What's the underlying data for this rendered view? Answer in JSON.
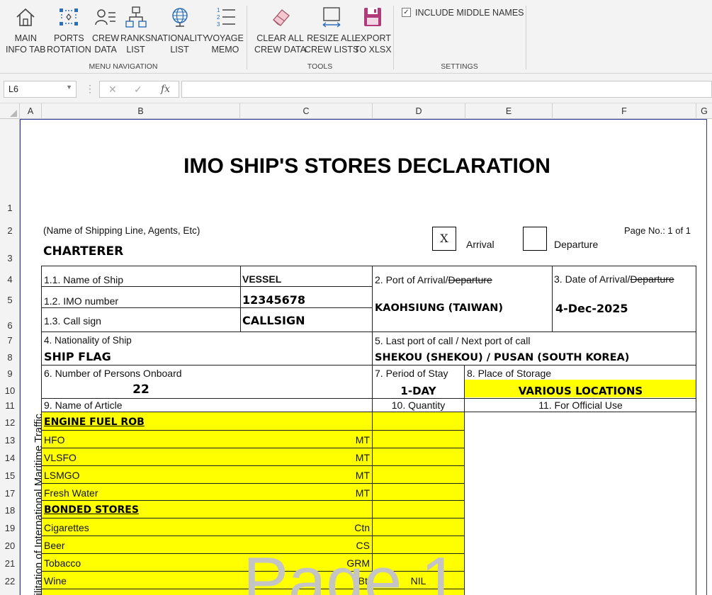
{
  "ribbon": {
    "buttons": [
      {
        "l1": "MAIN",
        "l2": "INFO TAB"
      },
      {
        "l1": "PORTS",
        "l2": "ROTATION"
      },
      {
        "l1": "CREW",
        "l2": "DATA"
      },
      {
        "l1": "RANKS",
        "l2": "LIST"
      },
      {
        "l1": "NATIONALITY",
        "l2": "LIST"
      },
      {
        "l1": "VOYAGE",
        "l2": "MEMO"
      },
      {
        "l1": "CLEAR ALL",
        "l2": "CREW DATA"
      },
      {
        "l1": "RESIZE ALL",
        "l2": "CREW LISTS"
      },
      {
        "l1": "EXPORT",
        "l2": "TO XLSX"
      }
    ],
    "groups": {
      "nav": "MENU NAVIGATION",
      "tools": "TOOLS",
      "settings": "SETTINGS"
    },
    "checkbox_label": "INCLUDE MIDDLE NAMES",
    "checkbox_mark": "✓"
  },
  "formula_bar": {
    "name_box": "L6",
    "fx": "fx",
    "formula": ""
  },
  "columns": [
    "A",
    "B",
    "C",
    "D",
    "E",
    "F",
    "G"
  ],
  "rows": [
    "1",
    "2",
    "3",
    "4",
    "5",
    "6",
    "7",
    "8",
    "9",
    "10",
    "11",
    "12",
    "13",
    "14",
    "15",
    "17",
    "18",
    "19",
    "20",
    "21",
    "22"
  ],
  "sheet": {
    "title": "IMO SHIP'S STORES DECLARATION",
    "shipping_line_label": "(Name of Shipping Line, Agents, Etc)",
    "shipping_line": "CHARTERER",
    "arrival_mark": "X",
    "arrival_label": "Arrival",
    "departure_label": "Departure",
    "page_no": "Page No.: 1 of 1",
    "ship_name_label": "1.1. Name of Ship",
    "ship_name": "VESSEL",
    "port_label_a": "2. Port of Arrival/",
    "port_label_b": "Departure",
    "date_label_a": "3. Date of Arrival/",
    "date_label_b": "Departure",
    "imo_label": "1.2. IMO number",
    "imo": "12345678",
    "port": "KAOHSIUNG (TAIWAN)",
    "date": "4-Dec-2025",
    "call_sign_label": "1.3. Call sign",
    "call_sign": "CALLSIGN",
    "nationality_label": "4. Nationality of Ship",
    "nationality": "SHIP FLAG",
    "last_port_label": "5. Last port of call / Next port of call",
    "last_port": "SHEKOU (SHEKOU) / PUSAN (SOUTH KOREA)",
    "persons_label": "6. Number of Persons Onboard",
    "persons": "22",
    "stay_label": "7. Period of Stay",
    "stay": "1-DAY",
    "storage_label": "8. Place of Storage",
    "storage": "VARIOUS LOCATIONS",
    "article_label": "9. Name of Article",
    "quantity_label": "10. Quantity",
    "official_label": "11. For Official Use",
    "side_text": "cilitation of International Maritime Traffic",
    "watermark": "Page 1",
    "articles": [
      {
        "name": "ENGINE FUEL ROB",
        "unit": "",
        "qty": "",
        "header": true
      },
      {
        "name": "HFO",
        "unit": "MT",
        "qty": ""
      },
      {
        "name": "VLSFO",
        "unit": "MT",
        "qty": ""
      },
      {
        "name": "LSMGO",
        "unit": "MT",
        "qty": ""
      },
      {
        "name": "Fresh Water",
        "unit": "MT",
        "qty": ""
      },
      {
        "name": "BONDED STORES",
        "unit": "",
        "qty": "",
        "header": true
      },
      {
        "name": "Cigarettes",
        "unit": "Ctn",
        "qty": ""
      },
      {
        "name": "Beer",
        "unit": "CS",
        "qty": ""
      },
      {
        "name": "Tobacco",
        "unit": "GRM",
        "qty": ""
      },
      {
        "name": "Wine",
        "unit": "Btl",
        "qty": "NIL"
      }
    ]
  }
}
